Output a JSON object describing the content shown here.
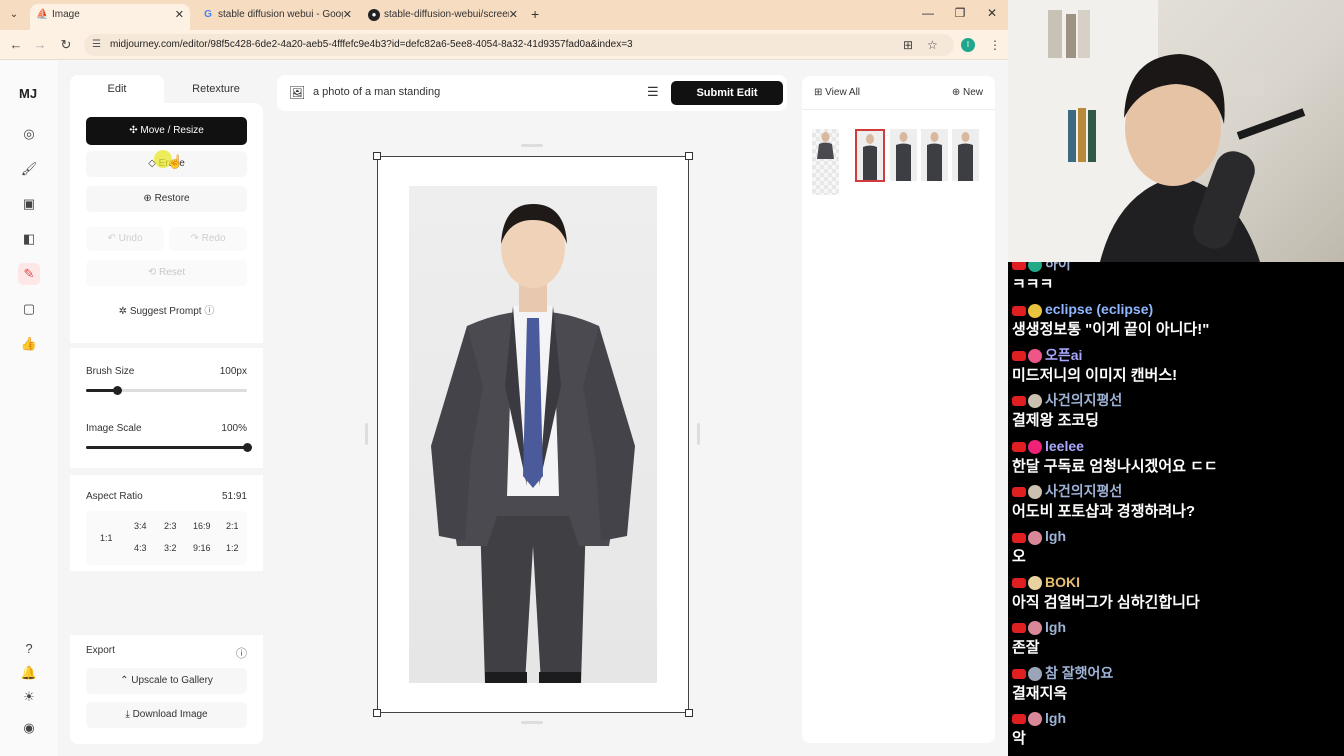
{
  "browser": {
    "tabs": [
      {
        "title": "Image",
        "icon": "midjourney-favicon",
        "active": true
      },
      {
        "title": "stable diffusion webui - Goog",
        "icon": "google-favicon",
        "active": false
      },
      {
        "title": "stable-diffusion-webui/screen",
        "icon": "github-favicon",
        "active": false
      }
    ],
    "url": "midjourney.com/editor/98f5c428-6de2-4a20-aeb5-4fffefc9e4b3?id=defc82a6-5ee8-4054-8a32-41d9357fad0a&index=3",
    "profile_initial": "I",
    "new_tab": "+"
  },
  "app": {
    "logo": "MJ",
    "nav_icons": [
      "explore-icon",
      "create-icon",
      "images-icon",
      "organize-icon",
      "edit-icon",
      "chat-icon",
      "rank-icon"
    ],
    "bottom_icons": [
      "help-icon",
      "bell-icon",
      "theme-icon",
      "profile-icon"
    ],
    "edit_panel": {
      "tabs": [
        "Edit",
        "Retexture"
      ],
      "move_resize": "Move / Resize",
      "erase": "Erase",
      "restore": "Restore",
      "undo": "Undo",
      "redo": "Redo",
      "reset": "Reset",
      "suggest_prompt": "Suggest Prompt",
      "brush_size_label": "Brush Size",
      "brush_size_value": "100px",
      "brush_size_fraction": 0.19,
      "image_scale_label": "Image Scale",
      "image_scale_value": "100%",
      "image_scale_fraction": 1.0,
      "aspect_ratio_label": "Aspect Ratio",
      "aspect_ratio_value": "51:91",
      "aspect_ratios_left": "1:1",
      "aspect_ratios_top": [
        "3:4",
        "2:3",
        "16:9",
        "2:1"
      ],
      "aspect_ratios_bottom": [
        "4:3",
        "3:2",
        "9:16",
        "1:2"
      ],
      "export_label": "Export",
      "upscale": "Upscale to Gallery",
      "download": "Download Image"
    },
    "prompt": {
      "text": "a photo of a man standing",
      "submit": "Submit Edit"
    },
    "gallery": {
      "view_all": "View All",
      "new": "New",
      "thumb_count": 5,
      "selected_index": 1
    }
  },
  "stream": {
    "chat": [
      {
        "name": "하이",
        "text": "ㅋㅋㅋ",
        "name_color": "#9fb3d6",
        "avatar_color": "#22aa88"
      },
      {
        "name": "eclipse (eclipse)",
        "text": "생생정보통 \"이게 끝이 아니다!\"",
        "name_color": "#8fb7ff",
        "avatar_color": "#e9c23f"
      },
      {
        "name": "오픈ai",
        "text": "미드저니의 이미지 캔버스!",
        "name_color": "#a9a9ff",
        "avatar_color": "#ee5588"
      },
      {
        "name": "사건의지평선",
        "text": "결제왕 조코딩",
        "name_color": "#9fb3d6",
        "avatar_color": "#ccc0b0"
      },
      {
        "name": "leelee",
        "text": "한달 구독료 엄청나시겠어요 ㄷㄷ",
        "name_color": "#a9a9ff",
        "avatar_color": "#ee2277"
      },
      {
        "name": "사건의지평선",
        "text": "어도비 포토샵과 경쟁하려나?",
        "name_color": "#9fb3d6",
        "avatar_color": "#ccc0b0"
      },
      {
        "name": "lgh",
        "text": "오",
        "name_color": "#9fb3d6",
        "avatar_color": "#d98899"
      },
      {
        "name": "BOKI",
        "text": "아직 검열버그가 심하긴합니다",
        "name_color": "#e8c070",
        "avatar_color": "#e8d3a0"
      },
      {
        "name": "lgh",
        "text": "존잘",
        "name_color": "#9fb3d6",
        "avatar_color": "#d98899"
      },
      {
        "name": "참 잘햇어요",
        "text": "결재지옥",
        "name_color": "#9fb3d6",
        "avatar_color": "#9aa6b8"
      },
      {
        "name": "lgh",
        "text": "악",
        "name_color": "#9fb3d6",
        "avatar_color": "#d98899"
      }
    ]
  }
}
